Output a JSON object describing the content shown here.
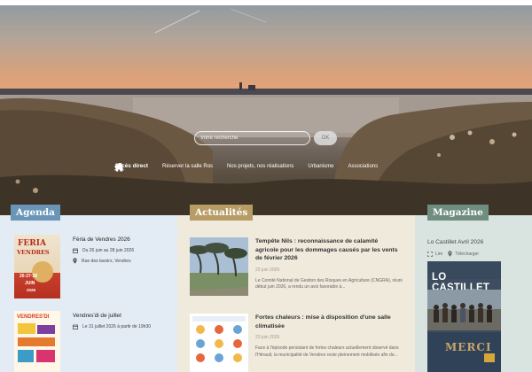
{
  "search": {
    "placeholder": "Votre recherche",
    "button_label": "OK"
  },
  "quick_access": {
    "title": "Accès direct",
    "items": [
      {
        "label": "Réserver la salle Ros",
        "icon": "key-icon"
      },
      {
        "label": "Nos projets, nos réalisations",
        "icon": "megaphone-icon"
      },
      {
        "label": "Urbanisme",
        "icon": "house-icon"
      },
      {
        "label": "Associations",
        "icon": "people-icon"
      }
    ]
  },
  "agenda": {
    "heading": "Agenda",
    "events": [
      {
        "title": "Féria de Vendres 2026",
        "date": "Du 26 juin au 28 juin 2026",
        "location": "Rue des lavoirs, Vendres",
        "poster_text": [
          "FERIA",
          "VENDRES",
          "26·27·28",
          "JUIN",
          "2026"
        ]
      },
      {
        "title": "Vendres'di de juillet",
        "date": "Le 31 juillet 2026 à partir de 19h30",
        "poster_text": [
          "VENDRES'DI"
        ]
      }
    ]
  },
  "actualites": {
    "heading": "Actualités",
    "items": [
      {
        "title": "Tempête Nils : reconnaissance de calamité agricole pour les dommages causés par les vents de février 2026",
        "date": "23 juin 2026",
        "excerpt": "Le Comité National de Gestion des Risques en Agriculture (CNGRA), réuni début juin 2026, a rendu un avis favorable à..."
      },
      {
        "title": "Fortes chaleurs : mise à disposition d'une salle climatisée",
        "date": "23 juin 2026",
        "excerpt": "Face à l'épisode persistant de fortes chaleurs actuellement observé dans l'Hérault, la municipalité de Vendres reste pleinement mobilisée afin de..."
      }
    ]
  },
  "magazine": {
    "heading": "Magazine",
    "title": "Lo Castillet Avril 2026",
    "read_label": "Lire",
    "download_label": "Télécharger",
    "cover_title": "LO CASTILLET",
    "cover_bottom": "MERCI"
  },
  "colors": {
    "agenda_accent": "#6b95b7",
    "actu_accent": "#b79c66",
    "magazine_accent": "#6f8e80"
  }
}
